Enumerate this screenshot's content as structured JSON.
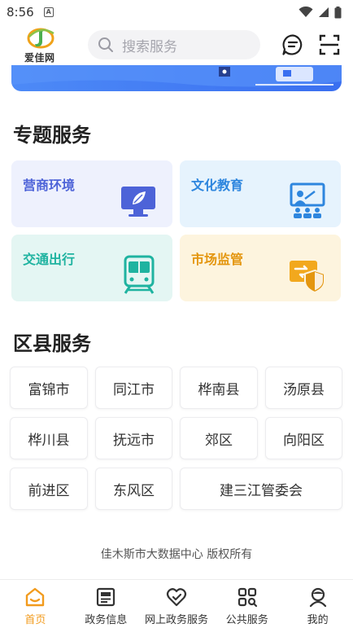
{
  "status_bar": {
    "time": "8:56",
    "badge": "A"
  },
  "header": {
    "logo_text": "爱佳网",
    "search_placeholder": "搜索服务"
  },
  "topics": {
    "title": "专题服务",
    "cards": [
      {
        "label": "营商环境",
        "color": "#4d63d8",
        "bg": "#eef1fd",
        "icon": "monitor-leaf-icon"
      },
      {
        "label": "文化教育",
        "color": "#2e86de",
        "bg": "#e6f3fd",
        "icon": "teacher-board-icon"
      },
      {
        "label": "交通出行",
        "color": "#1fb3a0",
        "bg": "#e4f6f3",
        "icon": "train-icon"
      },
      {
        "label": "市场监管",
        "color": "#e4960f",
        "bg": "#fdf4de",
        "icon": "shield-arrows-icon"
      }
    ]
  },
  "districts": {
    "title": "区县服务",
    "items": [
      "富锦市",
      "同江市",
      "桦南县",
      "汤原县",
      "桦川县",
      "抚远市",
      "郊区",
      "向阳区",
      "前进区",
      "东风区",
      "建三江管委会"
    ]
  },
  "footer": {
    "copyright": "佳木斯市大数据中心 版权所有"
  },
  "tabbar": {
    "items": [
      {
        "label": "首页",
        "icon": "home-icon",
        "active": true
      },
      {
        "label": "政务信息",
        "icon": "news-icon",
        "active": false
      },
      {
        "label": "网上政务服务",
        "icon": "heart-check-icon",
        "active": false
      },
      {
        "label": "公共服务",
        "icon": "grid-search-icon",
        "active": false
      },
      {
        "label": "我的",
        "icon": "user-icon",
        "active": false
      }
    ]
  },
  "colors": {
    "accent": "#f29b1d",
    "banner": "#3a6ff0"
  }
}
